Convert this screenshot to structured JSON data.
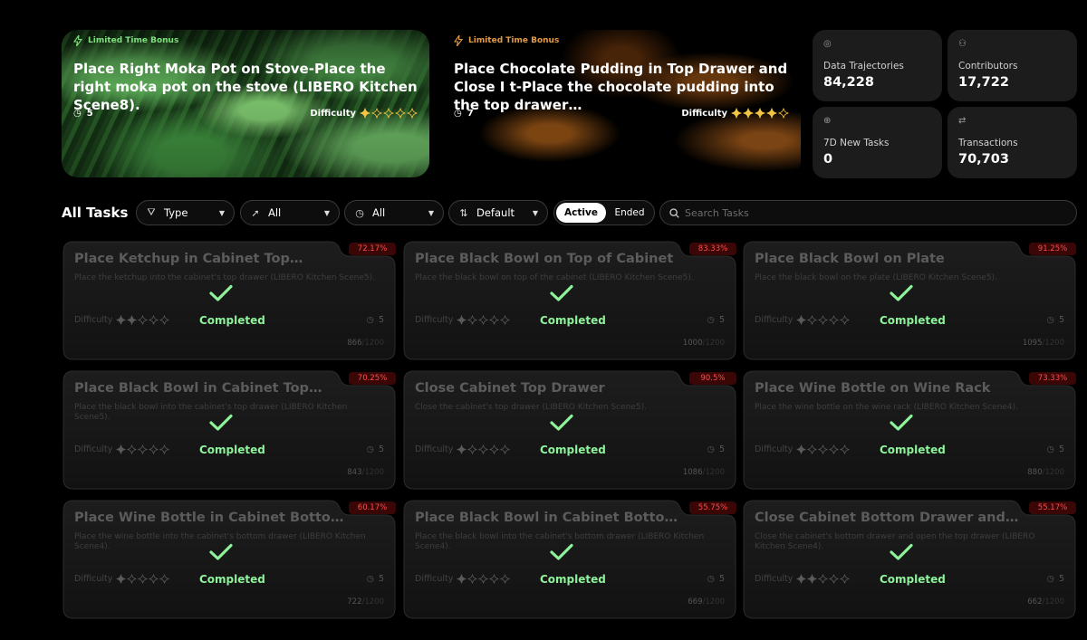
{
  "colors": {
    "accent_green": "#8df29a",
    "accent_orange": "#e49a44",
    "badge_red": "#ff4d4d"
  },
  "hero": [
    {
      "badge": "Limited Time Bonus",
      "title": "Place Right Moka Pot on Stove-Place the right moka pot on the stove (LIBERO Kitchen Scene8).",
      "count": "5",
      "difficulty_label": "Difficulty",
      "difficulty": 1
    },
    {
      "badge": "Limited Time Bonus",
      "title": "Place Chocolate Pudding in Top Drawer and Close I t-Place the chocolate pudding into the top drawer…",
      "count": "7",
      "difficulty_label": "Difficulty",
      "difficulty": 4
    }
  ],
  "stats": [
    {
      "label": "Data Trajectories",
      "value": "84,228",
      "icon": "target-icon"
    },
    {
      "label": "Contributors",
      "value": "17,722",
      "icon": "users-icon"
    },
    {
      "label": "7D New Tasks",
      "value": "0",
      "icon": "add-circle-icon"
    },
    {
      "label": "Transactions",
      "value": "70,703",
      "icon": "swap-icon"
    }
  ],
  "filters": {
    "heading": "All Tasks",
    "type_label": "Type",
    "reward_label": "All",
    "time_label": "All",
    "sort_label": "Default",
    "toggle_active": "Active",
    "toggle_ended": "Ended",
    "search_placeholder": "Search Tasks"
  },
  "tasks": [
    {
      "title": "Place Ketchup in Cabinet Top…",
      "desc": "Place the ketchup into the cabinet's top drawer (LIBERO Kitchen Scene5).",
      "pct": "72.17%",
      "difficulty": 2,
      "count": "5",
      "progress": "866",
      "total": "/1200",
      "status": "Completed"
    },
    {
      "title": "Place Black Bowl on Top of Cabinet",
      "desc": "Place the black bowl on top of the cabinet (LIBERO Kitchen Scene5).",
      "pct": "83.33%",
      "difficulty": 1,
      "count": "5",
      "progress": "1000",
      "total": "/1200",
      "status": "Completed"
    },
    {
      "title": "Place Black Bowl on Plate",
      "desc": "Place the black bowl on the plate (LIBERO Kitchen Scene5).",
      "pct": "91.25%",
      "difficulty": 1,
      "count": "5",
      "progress": "1095",
      "total": "/1200",
      "status": "Completed"
    },
    {
      "title": "Place Black Bowl in Cabinet Top…",
      "desc": "Place the black bowl into the cabinet's top drawer (LIBERO Kitchen Scene5).",
      "pct": "70.25%",
      "difficulty": 1,
      "count": "5",
      "progress": "843",
      "total": "/1200",
      "status": "Completed"
    },
    {
      "title": "Close Cabinet Top Drawer",
      "desc": "Close the cabinet's top drawer (LIBERO Kitchen Scene5).",
      "pct": "90.5%",
      "difficulty": 1,
      "count": "5",
      "progress": "1086",
      "total": "/1200",
      "status": "Completed"
    },
    {
      "title": "Place Wine Bottle on Wine Rack",
      "desc": "Place the wine bottle on the wine rack (LIBERO Kitchen Scene4).",
      "pct": "73.33%",
      "difficulty": 1,
      "count": "5",
      "progress": "880",
      "total": "/1200",
      "status": "Completed"
    },
    {
      "title": "Place Wine Bottle in Cabinet Botto…",
      "desc": "Place the wine bottle into the cabinet's bottom drawer (LIBERO Kitchen Scene4).",
      "pct": "60.17%",
      "difficulty": 1,
      "count": "5",
      "progress": "722",
      "total": "/1200",
      "status": "Completed"
    },
    {
      "title": "Place Black Bowl in Cabinet Botto…",
      "desc": "Place the black bowl into the cabinet's bottom drawer (LIBERO Kitchen Scene4).",
      "pct": "55.75%",
      "difficulty": 1,
      "count": "5",
      "progress": "669",
      "total": "/1200",
      "status": "Completed"
    },
    {
      "title": "Close Cabinet Bottom Drawer and…",
      "desc": "Close the cabinet's bottom drawer and open the top drawer (LIBERO Kitchen Scene4).",
      "pct": "55.17%",
      "difficulty": 2,
      "count": "5",
      "progress": "662",
      "total": "/1200",
      "status": "Completed"
    }
  ]
}
